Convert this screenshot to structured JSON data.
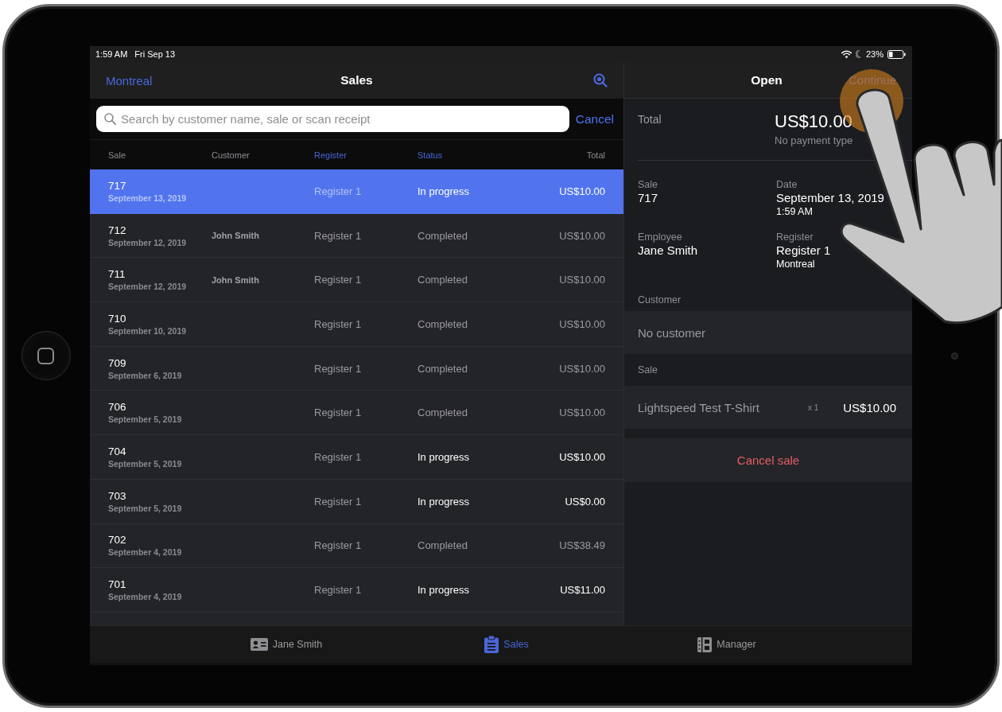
{
  "status_bar": {
    "time": "1:59 AM",
    "date": "Fri Sep 13",
    "battery": "23%"
  },
  "sales_list": {
    "location": "Montreal",
    "title": "Sales",
    "search": {
      "placeholder": "Search by customer name, sale or scan receipt"
    },
    "cancel": "Cancel",
    "columns": [
      {
        "label": "Sale",
        "active": false
      },
      {
        "label": "Customer",
        "active": false
      },
      {
        "label": "Register",
        "active": true
      },
      {
        "label": "Status",
        "active": true
      },
      {
        "label": "Total",
        "active": false
      }
    ],
    "rows": [
      {
        "sale": "717",
        "date": "September 13, 2019",
        "register": "Register 1",
        "status": "In progress",
        "kind": "in_progress",
        "total": "US$10.00",
        "selected": true
      },
      {
        "sale": "712",
        "date": "September 12, 2019",
        "customer": "John Smith",
        "register": "Register 1",
        "status": "Completed",
        "kind": "completed",
        "total": "US$10.00",
        "selected": false
      },
      {
        "sale": "711",
        "date": "September 12, 2019",
        "customer": "John Smith",
        "register": "Register 1",
        "status": "Completed",
        "kind": "completed",
        "total": "US$10.00",
        "selected": false
      },
      {
        "sale": "710",
        "date": "September 10, 2019",
        "register": "Register 1",
        "status": "Completed",
        "kind": "completed",
        "total": "US$10.00",
        "selected": false
      },
      {
        "sale": "709",
        "date": "September 6, 2019",
        "register": "Register 1",
        "status": "Completed",
        "kind": "completed",
        "total": "US$10.00",
        "selected": false
      },
      {
        "sale": "706",
        "date": "September 5, 2019",
        "register": "Register 1",
        "status": "Completed",
        "kind": "completed",
        "total": "US$10.00",
        "selected": false
      },
      {
        "sale": "704",
        "date": "September 5, 2019",
        "register": "Register 1",
        "status": "In progress",
        "kind": "in_progress",
        "total": "US$10.00",
        "selected": false
      },
      {
        "sale": "703",
        "date": "September 5, 2019",
        "register": "Register 1",
        "status": "In progress",
        "kind": "in_progress",
        "total": "US$0.00",
        "selected": false
      },
      {
        "sale": "702",
        "date": "September 4, 2019",
        "register": "Register 1",
        "status": "Completed",
        "kind": "completed",
        "total": "US$38.49",
        "selected": false
      },
      {
        "sale": "701",
        "date": "September 4, 2019",
        "register": "Register 1",
        "status": "In progress",
        "kind": "in_progress",
        "total": "US$11.00",
        "selected": false
      }
    ]
  },
  "sale_detail": {
    "title": "Open",
    "action": "Continue",
    "total": {
      "label": "Total",
      "amount": "US$10.00",
      "payment": "No payment type"
    },
    "fields": [
      {
        "label": "Sale",
        "value": "717"
      },
      {
        "label": "Date",
        "value": "September 13, 2019",
        "note": "1:59 AM"
      },
      {
        "label": "Employee",
        "value": "Jane Smith"
      },
      {
        "label": "Register",
        "value": "Register 1",
        "note": "Montreal"
      }
    ],
    "customer": {
      "heading": "Customer",
      "value": "No customer"
    },
    "sale": {
      "heading": "Sale",
      "items": [
        {
          "name": "Lightspeed Test T-Shirt",
          "quantity": "x 1",
          "price": "US$10.00"
        }
      ]
    },
    "cancel": "Cancel sale"
  },
  "tab_bar": [
    {
      "label": "Jane Smith",
      "kind": "employee",
      "selected": false
    },
    {
      "label": "Sales",
      "kind": "sales",
      "selected": true
    },
    {
      "label": "Manager",
      "kind": "manager",
      "selected": false
    }
  ]
}
